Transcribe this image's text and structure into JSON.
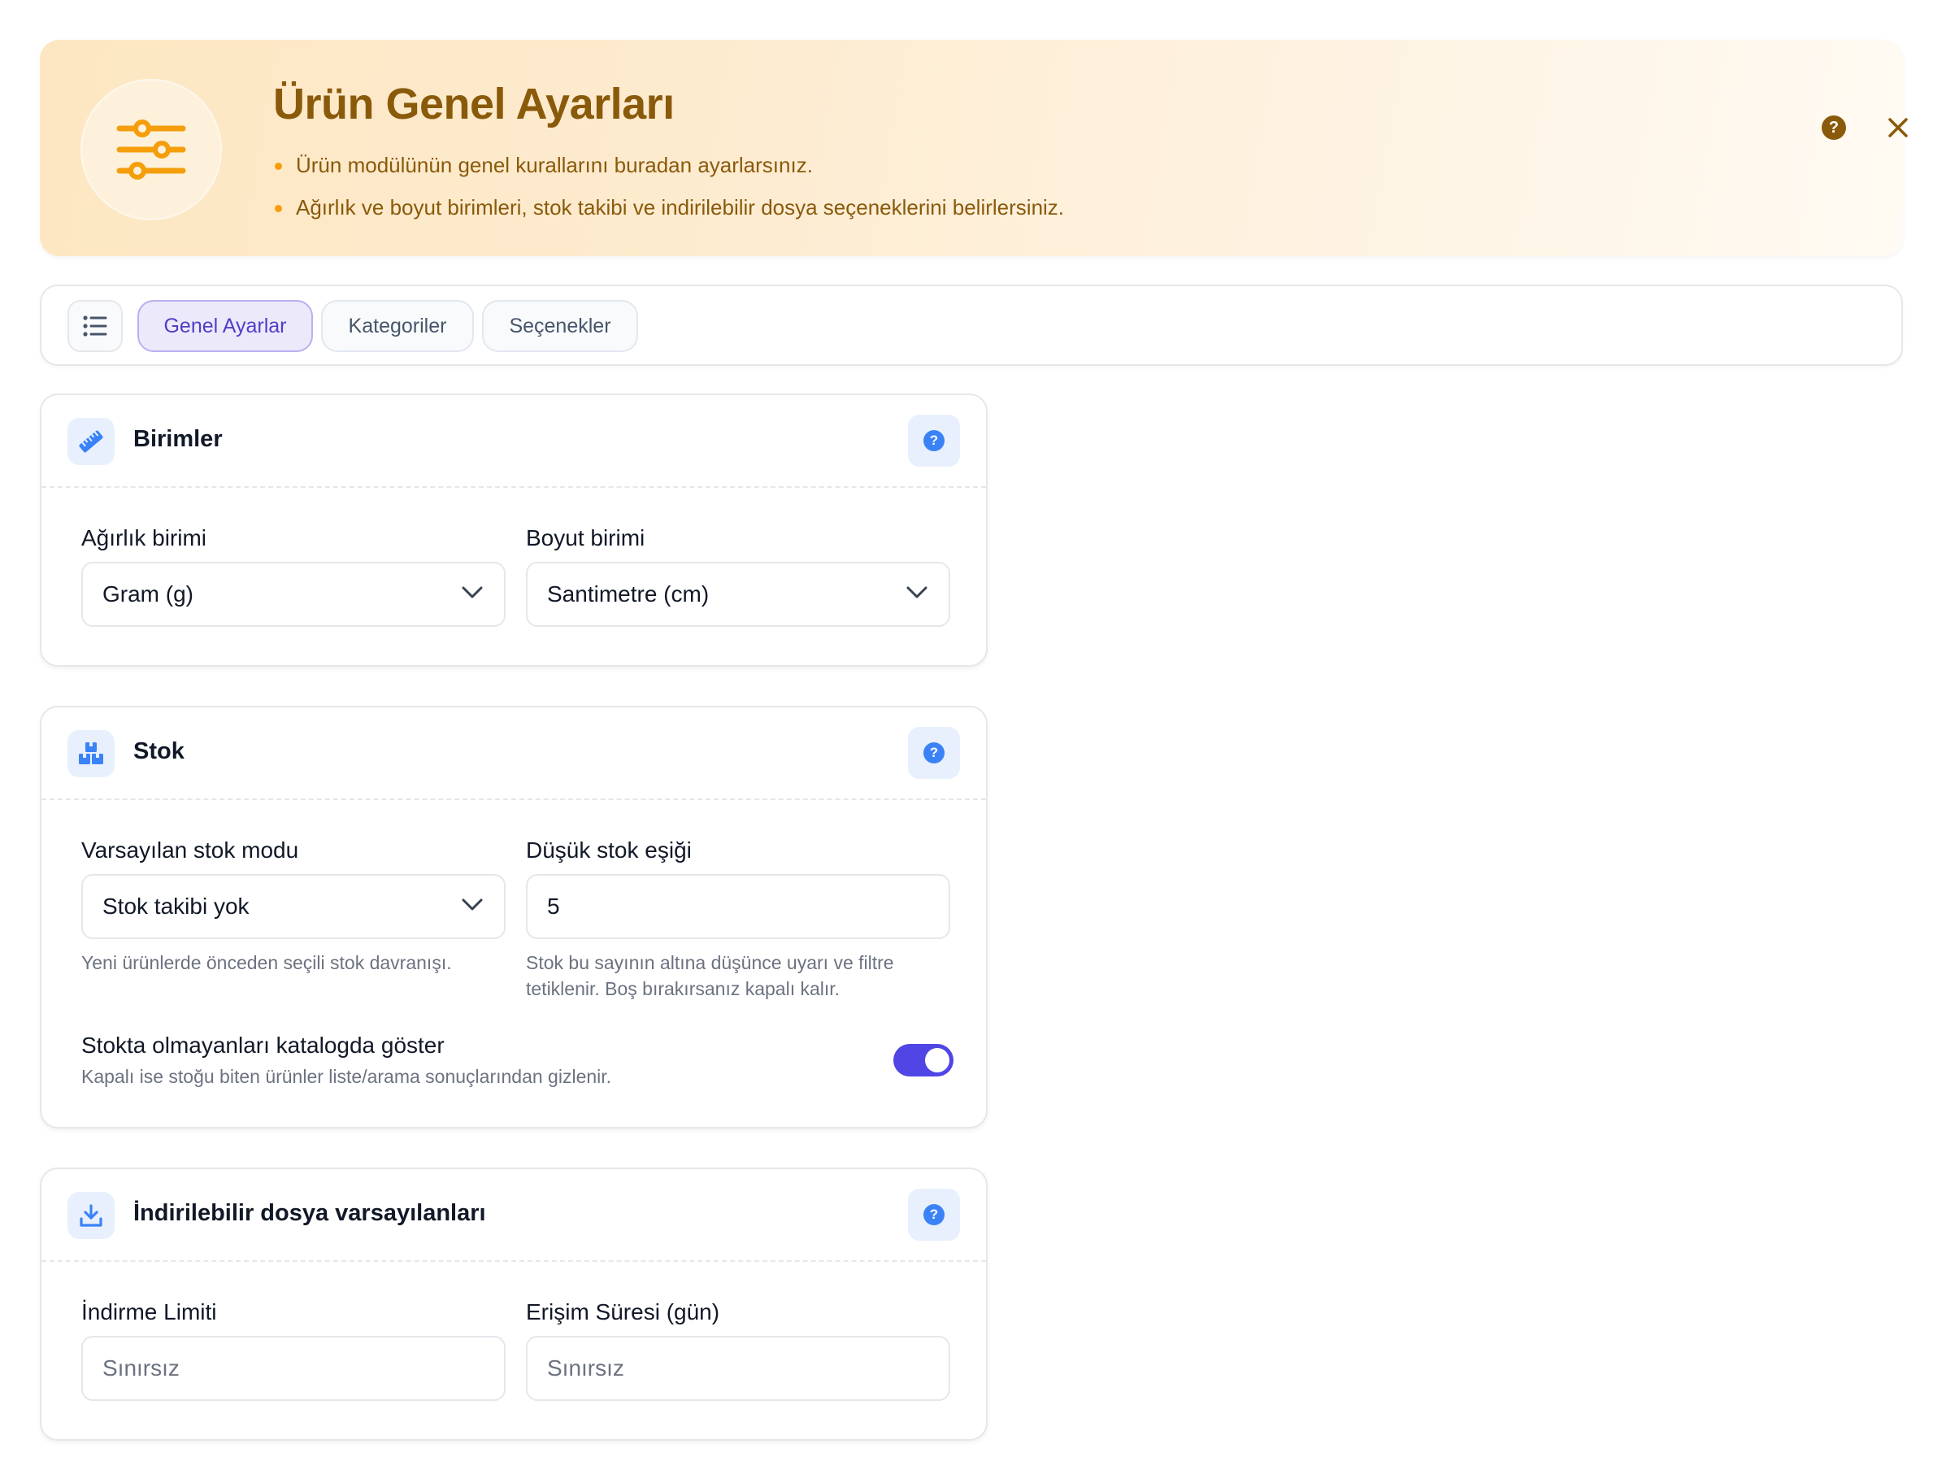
{
  "banner": {
    "title": "Ürün Genel Ayarları",
    "bullets": [
      "Ürün modülünün genel kurallarını buradan ayarlarsınız.",
      "Ağırlık ve boyut birimleri, stok takibi ve indirilebilir dosya seçeneklerini belirlersiniz."
    ],
    "help_glyph": "?",
    "icon": "sliders-icon",
    "accent_color": "#f59e0b"
  },
  "tabs": [
    {
      "label": "Genel Ayarlar",
      "active": true
    },
    {
      "label": "Kategoriler",
      "active": false
    },
    {
      "label": "Seçenekler",
      "active": false
    }
  ],
  "units": {
    "title": "Birimler",
    "help_glyph": "?",
    "weight": {
      "label": "Ağırlık birimi",
      "value": "Gram (g)"
    },
    "dimension": {
      "label": "Boyut birimi",
      "value": "Santimetre (cm)"
    }
  },
  "stock": {
    "title": "Stok",
    "help_glyph": "?",
    "mode": {
      "label": "Varsayılan stok modu",
      "value": "Stok takibi yok",
      "hint": "Yeni ürünlerde önceden seçili stok davranışı."
    },
    "threshold": {
      "label": "Düşük stok eşiği",
      "value": "5",
      "hint": "Stok bu sayının altına düşünce uyarı ve filtre tetiklenir. Boş bırakırsanız kapalı kalır."
    },
    "show_out_of_stock": {
      "label": "Stokta olmayanları katalogda göster",
      "hint": "Kapalı ise stoğu biten ürünler liste/arama sonuçlarından gizlenir.",
      "enabled": true
    }
  },
  "downloads": {
    "title": "İndirilebilir dosya varsayılanları",
    "help_glyph": "?",
    "limit": {
      "label": "İndirme Limiti",
      "placeholder": "Sınırsız"
    },
    "expiry": {
      "label": "Erişim Süresi (gün)",
      "placeholder": "Sınırsız"
    }
  }
}
